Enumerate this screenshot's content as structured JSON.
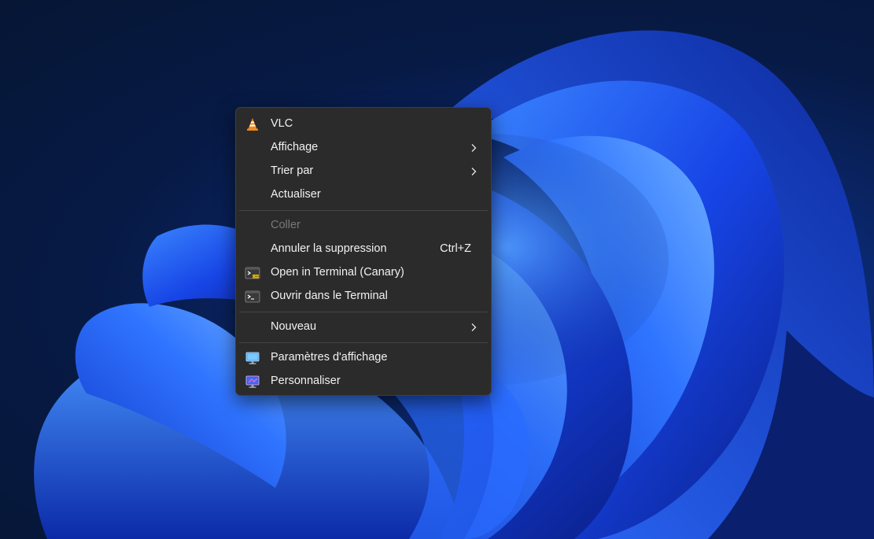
{
  "menu": {
    "vlc": "VLC",
    "affichage": "Affichage",
    "trier": "Trier par",
    "actualiser": "Actualiser",
    "coller": "Coller",
    "annuler": "Annuler la suppression",
    "annuler_shortcut": "Ctrl+Z",
    "open_terminal_canary": "Open in Terminal (Canary)",
    "ouvrir_terminal": "Ouvrir dans le Terminal",
    "nouveau": "Nouveau",
    "parametres": "Paramètres d'affichage",
    "personnaliser": "Personnaliser"
  },
  "icons": {
    "vlc": "vlc-cone-icon",
    "terminal_canary": "terminal-canary-icon",
    "terminal": "terminal-icon",
    "display_settings": "display-settings-icon",
    "personalize": "personalize-icon",
    "submenu": "chevron-right-icon"
  },
  "colors": {
    "menu_background": "#2b2b2b",
    "menu_text": "#f2f2f2",
    "disabled_text": "#7a7a7a",
    "separator": "#444444",
    "vlc_orange": "#f08a1c",
    "wallpaper_blue": "#1d5cff"
  }
}
